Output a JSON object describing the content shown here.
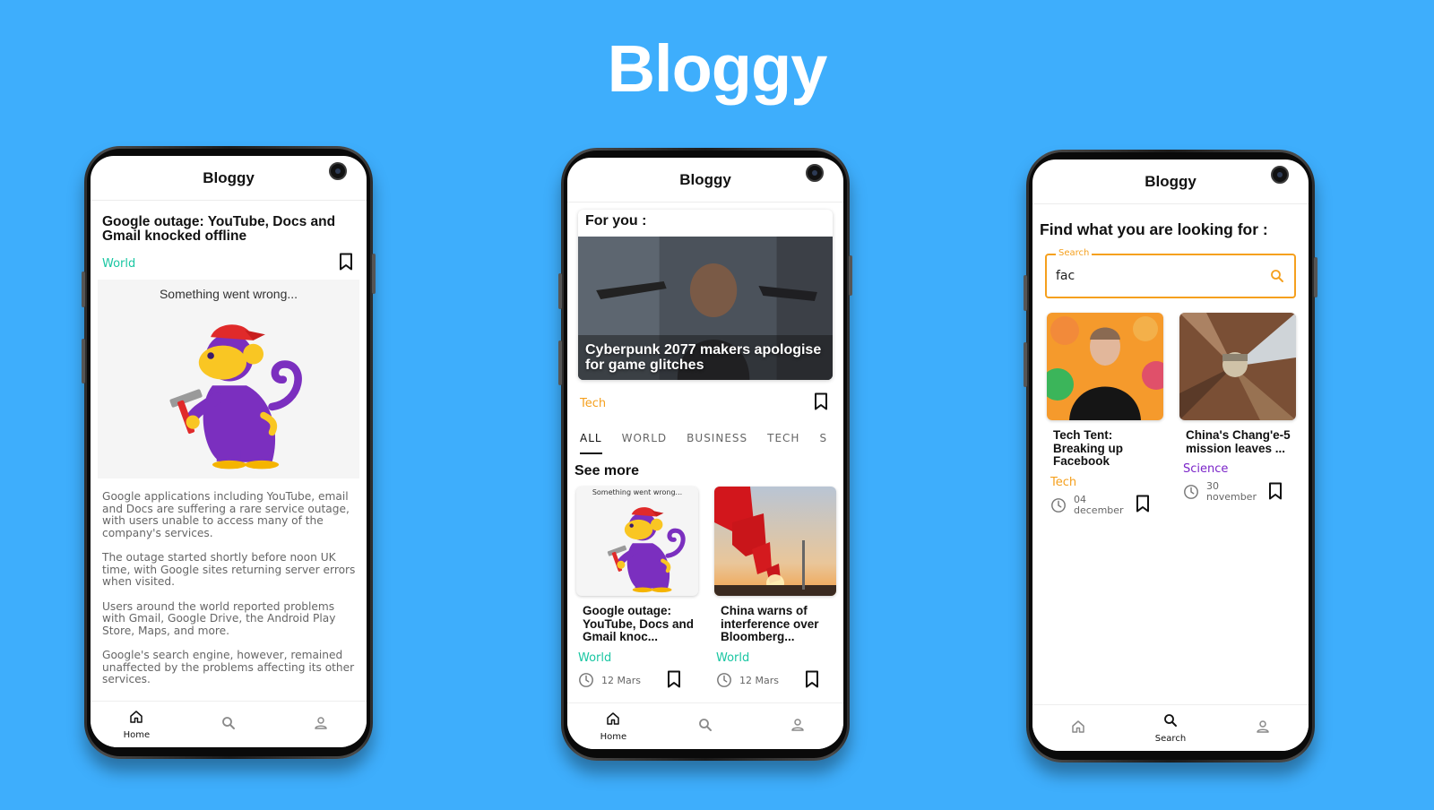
{
  "hero": {
    "title": "Bloggy"
  },
  "phone1": {
    "app_title": "Bloggy",
    "article": {
      "title": "Google outage: YouTube, Docs and Gmail knocked offline",
      "category": "World",
      "image_error": "Something went wrong...",
      "paragraphs": [
        "Google applications including YouTube, email and Docs are suffering a rare service outage, with users unable to access many of the company's services.",
        "The outage started shortly before noon UK time, with Google sites returning server errors when visited.",
        "Users around the world reported problems with Gmail, Google Drive, the Android Play Store, Maps, and more.",
        "Google's search engine, however, remained unaffected by the problems affecting its other services."
      ]
    },
    "nav": {
      "home": "Home"
    }
  },
  "phone2": {
    "app_title": "Bloggy",
    "for_you": {
      "heading": "For you :",
      "caption": "Cyberpunk 2077 makers apologise for game glitches",
      "category": "Tech"
    },
    "tabs": [
      "ALL",
      "WORLD",
      "BUSINESS",
      "TECH",
      "S"
    ],
    "see_more": "See more",
    "cards": [
      {
        "image_error": "Something went wrong...",
        "title": "Google outage: YouTube, Docs and Gmail knoc...",
        "category": "World",
        "date": "12 Mars"
      },
      {
        "title": "China warns of interference over Bloomberg...",
        "category": "World",
        "date": "12 Mars"
      }
    ],
    "nav": {
      "home": "Home"
    }
  },
  "phone3": {
    "app_title": "Bloggy",
    "heading": "Find what you are looking for :",
    "search": {
      "label": "Search",
      "value": "fac"
    },
    "results": [
      {
        "title": "Tech Tent: Breaking up Facebook",
        "category": "Tech",
        "date_day": "04",
        "date_month": "december"
      },
      {
        "title": "China's Chang'e-5 mission leaves ...",
        "category": "Science",
        "date_day": "30",
        "date_month": "november"
      }
    ],
    "nav": {
      "search": "Search"
    }
  },
  "colors": {
    "background": "#3eaefc",
    "world": "#19c6a2",
    "tech": "#f5a01e",
    "science": "#7b25c9",
    "accent": "#f5a01e"
  }
}
